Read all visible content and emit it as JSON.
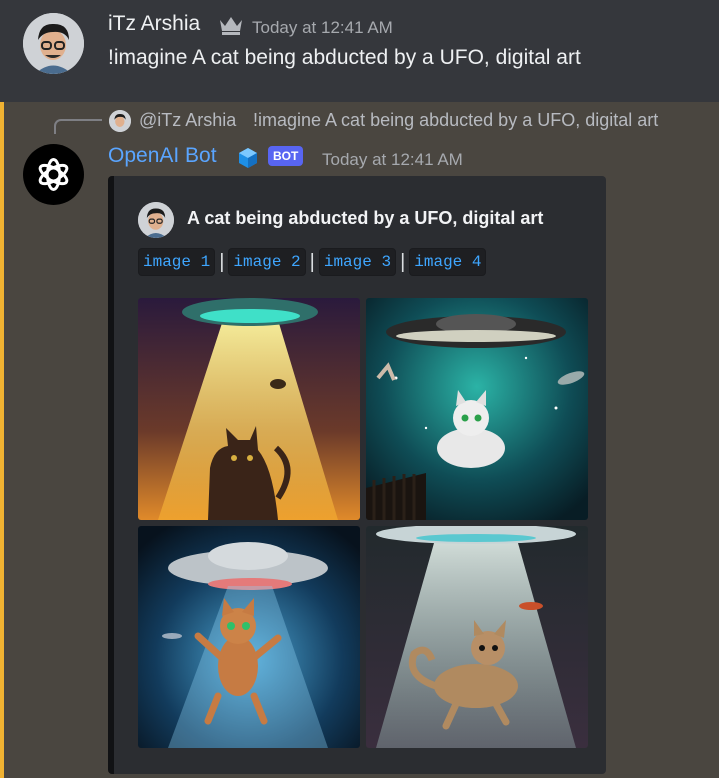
{
  "messages": {
    "user": {
      "username": "iTz Arshia",
      "timestamp": "Today at 12:41 AM",
      "text": "!imagine A cat being abducted by a UFO, digital art"
    },
    "reply": {
      "mention": "@iTz Arshia",
      "text": "!imagine A cat being abducted by a UFO, digital art"
    },
    "bot": {
      "username": "OpenAI Bot",
      "tag": "BOT",
      "timestamp": "Today at 12:41 AM",
      "embed": {
        "title": "A cat being abducted by a UFO, digital art",
        "links": [
          "image 1",
          "image 2",
          "image 3",
          "image 4"
        ],
        "separator": "|"
      }
    }
  },
  "colors": {
    "bot_name": "#5aa5ff",
    "mention_bar": "#f0b232",
    "bot_tag": "#5865f2",
    "link": "#3ea6ff"
  }
}
